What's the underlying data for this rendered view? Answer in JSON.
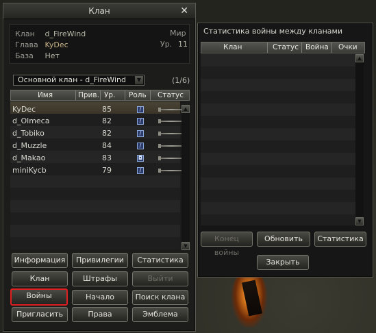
{
  "clan_window": {
    "title": "Клан",
    "close_icon": "close-icon",
    "info": {
      "clan_label": "Клан",
      "clan_value": "d_FireWind",
      "leader_label": "Глава",
      "leader_value": "KyDec",
      "base_label": "База",
      "base_value": "Нет",
      "world_label": "Мир",
      "level_label": "Ур.",
      "level_value": "11"
    },
    "subclan_select": "Основной клан - d_FireWind",
    "pager": "(1/6)",
    "columns": {
      "name": "Имя",
      "privilege": "Прив.",
      "level": "Ур.",
      "role": "Роль",
      "status": "Статус"
    },
    "members": [
      {
        "name": "KyDec",
        "level": "85",
        "role_icon": "sword-role-icon"
      },
      {
        "name": "d_Olmeca",
        "level": "82",
        "role_icon": "sword-role-icon"
      },
      {
        "name": "d_Tobiko",
        "level": "82",
        "role_icon": "wand-role-icon"
      },
      {
        "name": "d_Muzzle",
        "level": "84",
        "role_icon": "wand-role-icon"
      },
      {
        "name": "d_Makao",
        "level": "83",
        "role_icon": "shield-role-icon"
      },
      {
        "name": "miniKycb",
        "level": "79",
        "role_icon": "sword-role-icon"
      }
    ],
    "buttons": {
      "info": "Информация",
      "privileges": "Привилегии",
      "statistics": "Статистика",
      "clan": "Клан",
      "penalties": "Штрафы",
      "leave": "Выйти",
      "wars": "Войны",
      "start_war": "Начало войны",
      "search_clan": "Поиск клана",
      "invite": "Пригласить",
      "rights": "Права",
      "emblem": "Эмблема"
    }
  },
  "stats_window": {
    "title": "Статистика войны между кланами",
    "columns": {
      "clan": "Клан",
      "status": "Статус",
      "war": "Война",
      "points": "Очки"
    },
    "buttons": {
      "end_war": "Конец войны",
      "refresh": "Обновить",
      "statistics": "Статистика",
      "close": "Закрыть"
    }
  },
  "colors": {
    "active_button_border": "#e02020",
    "leader_name": "#c8b488"
  }
}
